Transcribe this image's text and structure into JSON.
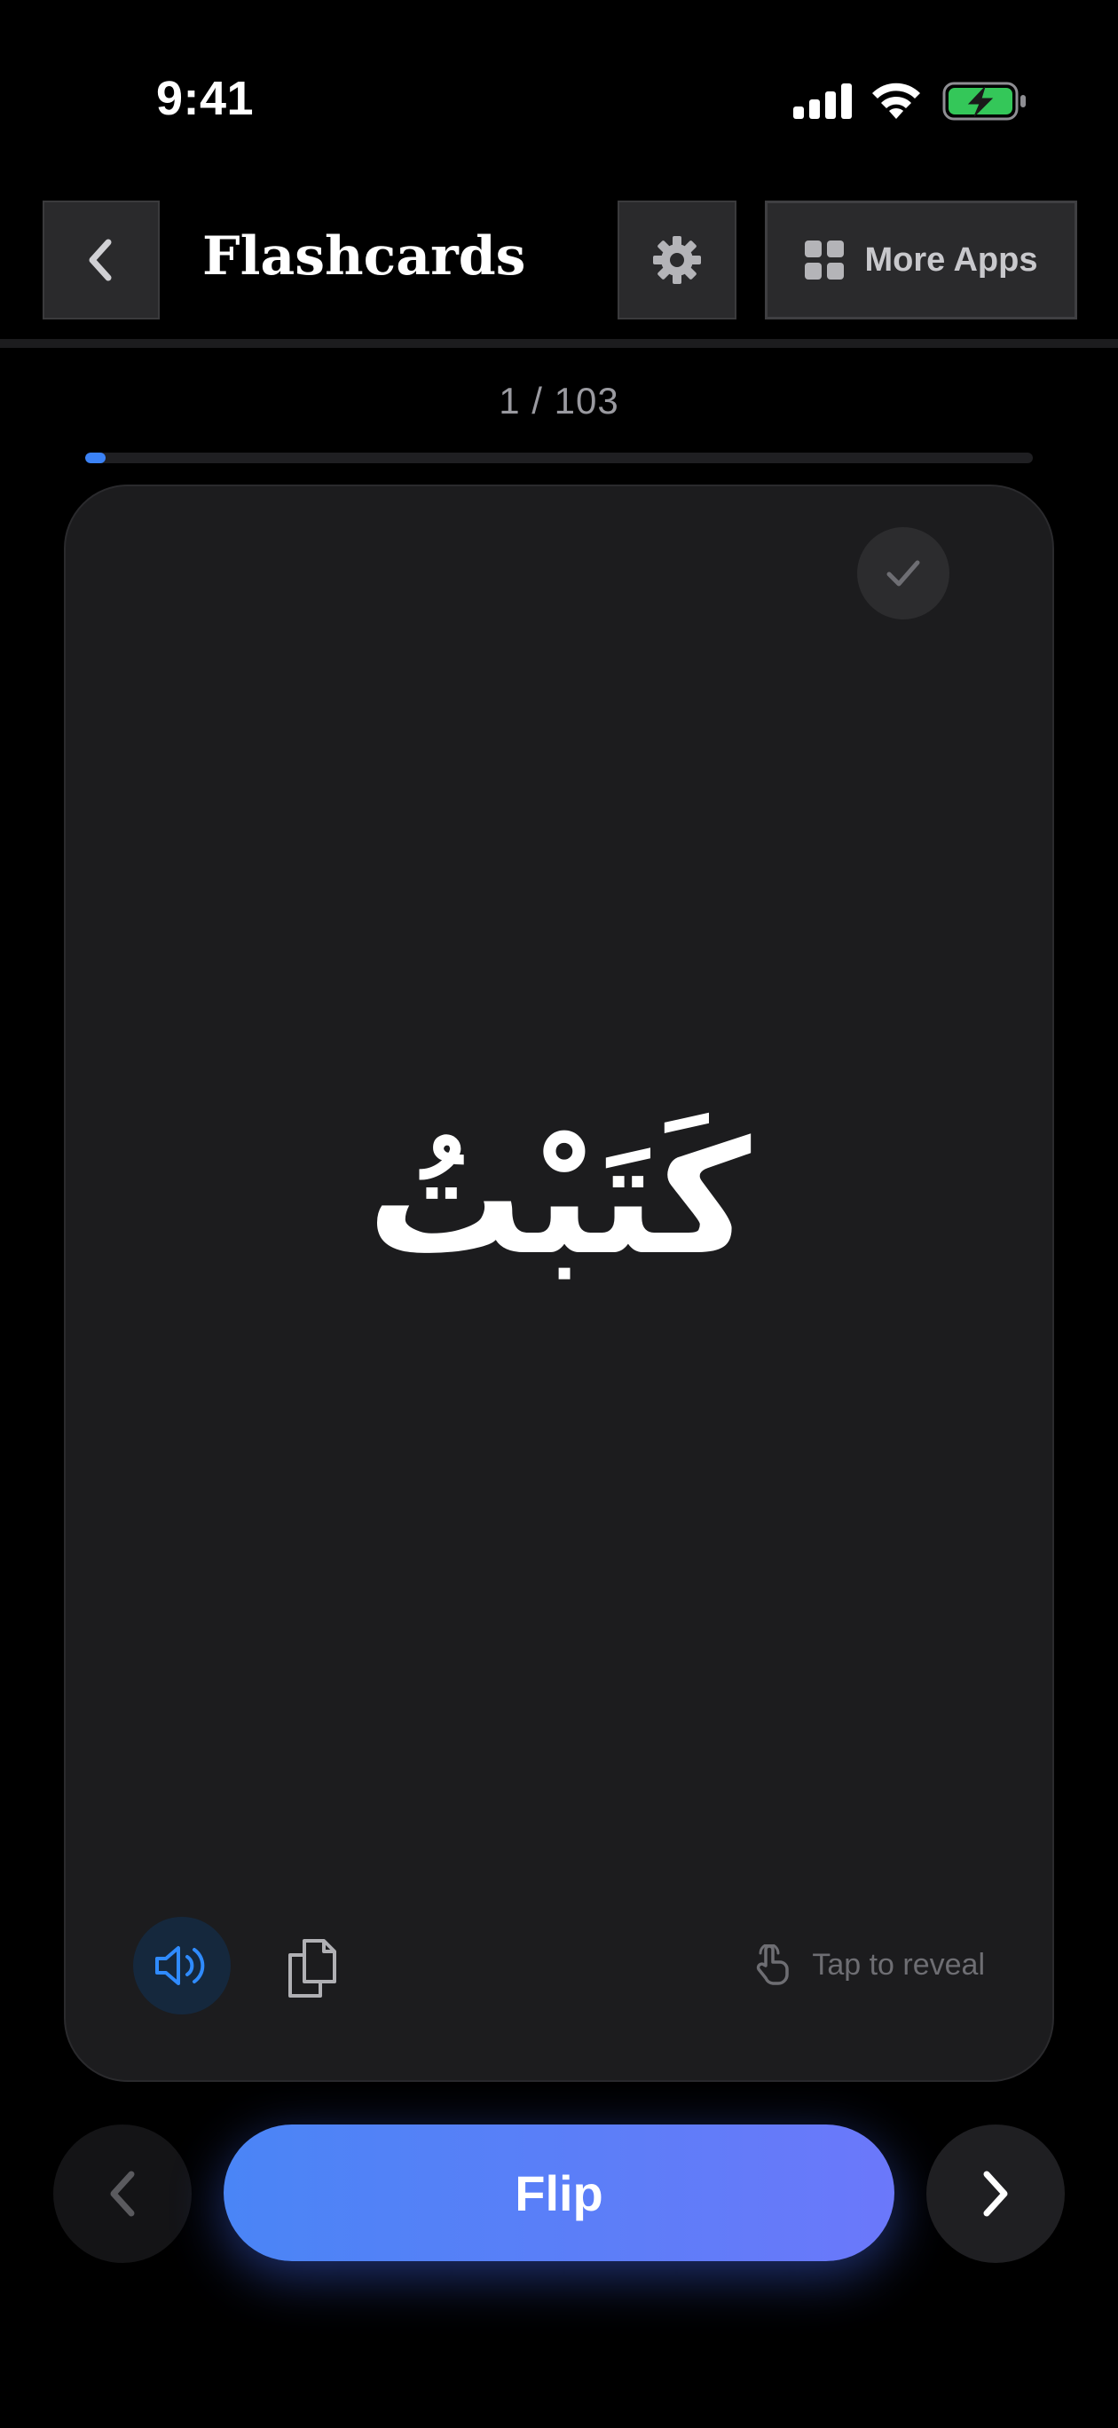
{
  "status_bar": {
    "time": "9:41",
    "battery_color": "#34c759"
  },
  "header": {
    "title": "Flashcards",
    "more_apps_label": "More Apps"
  },
  "progress": {
    "current": 1,
    "total": 103,
    "label": "1 / 103",
    "fraction": 0.0097
  },
  "card": {
    "word": "كَتَبْتُ",
    "tap_hint": "Tap to reveal",
    "known_checked": false
  },
  "controls": {
    "flip_label": "Flip"
  },
  "colors": {
    "accent": "#3b82f6",
    "flip_gradient_start": "#4a85f6",
    "flip_gradient_end": "#6b78fa",
    "card_background": "#1c1c1e",
    "speaker_icon": "#2f8bff"
  },
  "icons": {
    "back": "chevron-left-icon",
    "settings": "gear-icon",
    "more_apps": "grid-icon",
    "known": "checkmark-icon",
    "speak": "speaker-icon",
    "copy": "copy-icon",
    "tap": "hand-pointer-icon",
    "prev": "chevron-left-icon",
    "next": "chevron-right-icon"
  }
}
